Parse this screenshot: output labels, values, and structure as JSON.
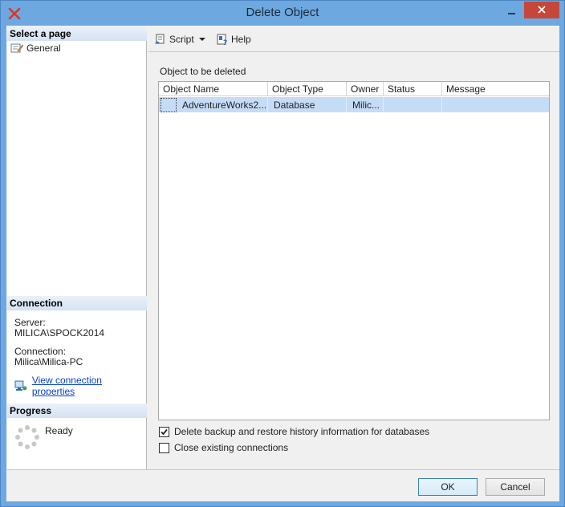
{
  "window": {
    "title": "Delete Object"
  },
  "sidebar": {
    "select_page_header": "Select a page",
    "pages": [
      {
        "label": "General",
        "icon": "page-properties-icon"
      }
    ],
    "connection_header": "Connection",
    "server_label": "Server:",
    "server_value": "MILICA\\SPOCK2014",
    "connection_label": "Connection:",
    "connection_value": "Milica\\Milica-PC",
    "view_connection_link": "View connection properties",
    "progress_header": "Progress",
    "progress_status": "Ready"
  },
  "toolbar": {
    "script_label": "Script",
    "help_label": "Help"
  },
  "main": {
    "group_label": "Object to be deleted",
    "columns": [
      "Object Name",
      "Object Type",
      "Owner",
      "Status",
      "Message"
    ],
    "rows": [
      {
        "object_name": "AdventureWorks2...",
        "object_type": "Database",
        "owner": "Milic...",
        "status": "",
        "message": ""
      }
    ],
    "options": [
      {
        "label": "Delete backup and restore history information for databases",
        "checked": true
      },
      {
        "label": "Close existing connections",
        "checked": false
      }
    ]
  },
  "buttons": {
    "ok": "OK",
    "cancel": "Cancel"
  },
  "colors": {
    "title_bar": "#6ea8e0",
    "close_button": "#c7463a",
    "selected_row": "#c5dcf7",
    "link": "#0a41c8"
  }
}
